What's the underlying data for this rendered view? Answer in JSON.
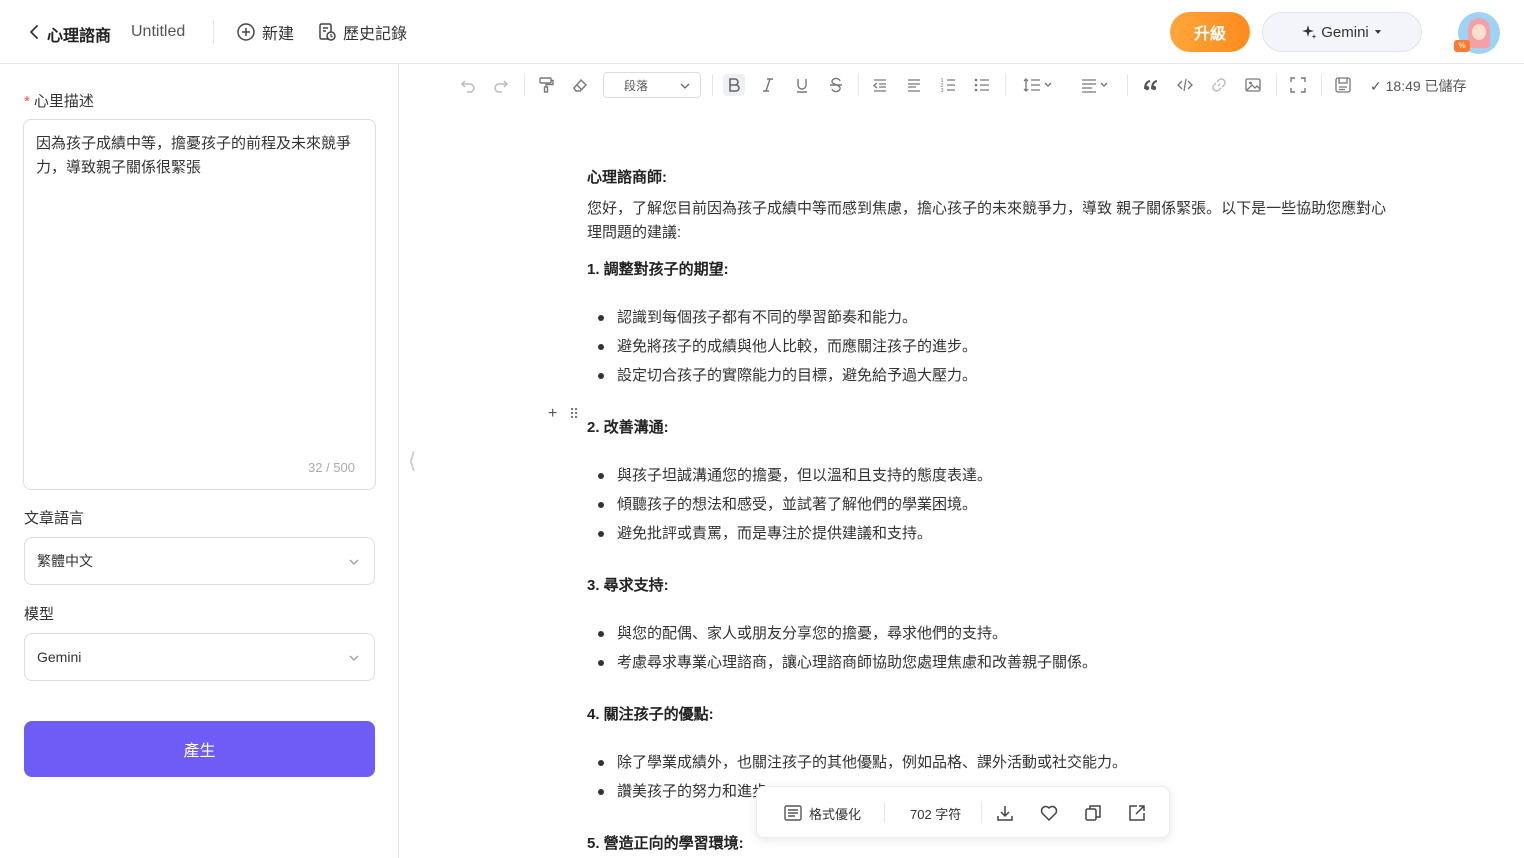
{
  "header": {
    "app_title": "心理諮商",
    "doc_title": "Untitled",
    "new_label": "新建",
    "history_label": "歷史記錄",
    "upgrade_label": "升級",
    "model_label": "Gemini",
    "avatar_badge": "%"
  },
  "left": {
    "desc_label": "心里描述",
    "required_mark": "*",
    "desc_value": "因為孩子成績中等，擔憂孩子的前程及未來競爭力，導致親子關係很緊張",
    "char_count": "32 / 500",
    "lang_label": "文章語言",
    "lang_value": "繁體中文",
    "model_label": "模型",
    "model_value": "Gemini",
    "generate_label": "產生"
  },
  "toolbar": {
    "paragraph_select": "段落",
    "saved_status": "✓ 18:49 已儲存"
  },
  "document": {
    "heading": "心理諮商師:",
    "intro": "您好，了解您目前因為孩子成績中等而感到焦慮，擔心孩子的未來競爭力，導致 親子關係緊張。以下是一些協助您應對心理問題的建議:",
    "sections": [
      {
        "title": "1. 調整對孩子的期望:",
        "items": [
          "認識到每個孩子都有不同的學習節奏和能力。",
          "避免將孩子的成績與他人比較，而應關注孩子的進步。",
          "設定切合孩子的實際能力的目標，避免給予過大壓力。"
        ]
      },
      {
        "title": "2. 改善溝通:",
        "items": [
          "與孩子坦誠溝通您的擔憂，但以溫和且支持的態度表達。",
          "傾聽孩子的想法和感受，並試著了解他們的學業困境。",
          "避免批評或責罵，而是專注於提供建議和支持。"
        ]
      },
      {
        "title": "3. 尋求支持:",
        "items": [
          "與您的配偶、家人或朋友分享您的擔憂，尋求他們的支持。",
          "考慮尋求專業心理諮商，讓心理諮商師協助您處理焦慮和改善親子關係。"
        ]
      },
      {
        "title": "4. 關注孩子的優點:",
        "items": [
          "除了學業成績外，也關注孩子的其他優點，例如品格、課外活動或社交能力。",
          "讚美孩子的努力和進步"
        ]
      },
      {
        "title": "5. 營造正向的學習環境:",
        "items": []
      }
    ]
  },
  "float_bar": {
    "format_label": "格式優化",
    "word_count": "702 字符"
  }
}
